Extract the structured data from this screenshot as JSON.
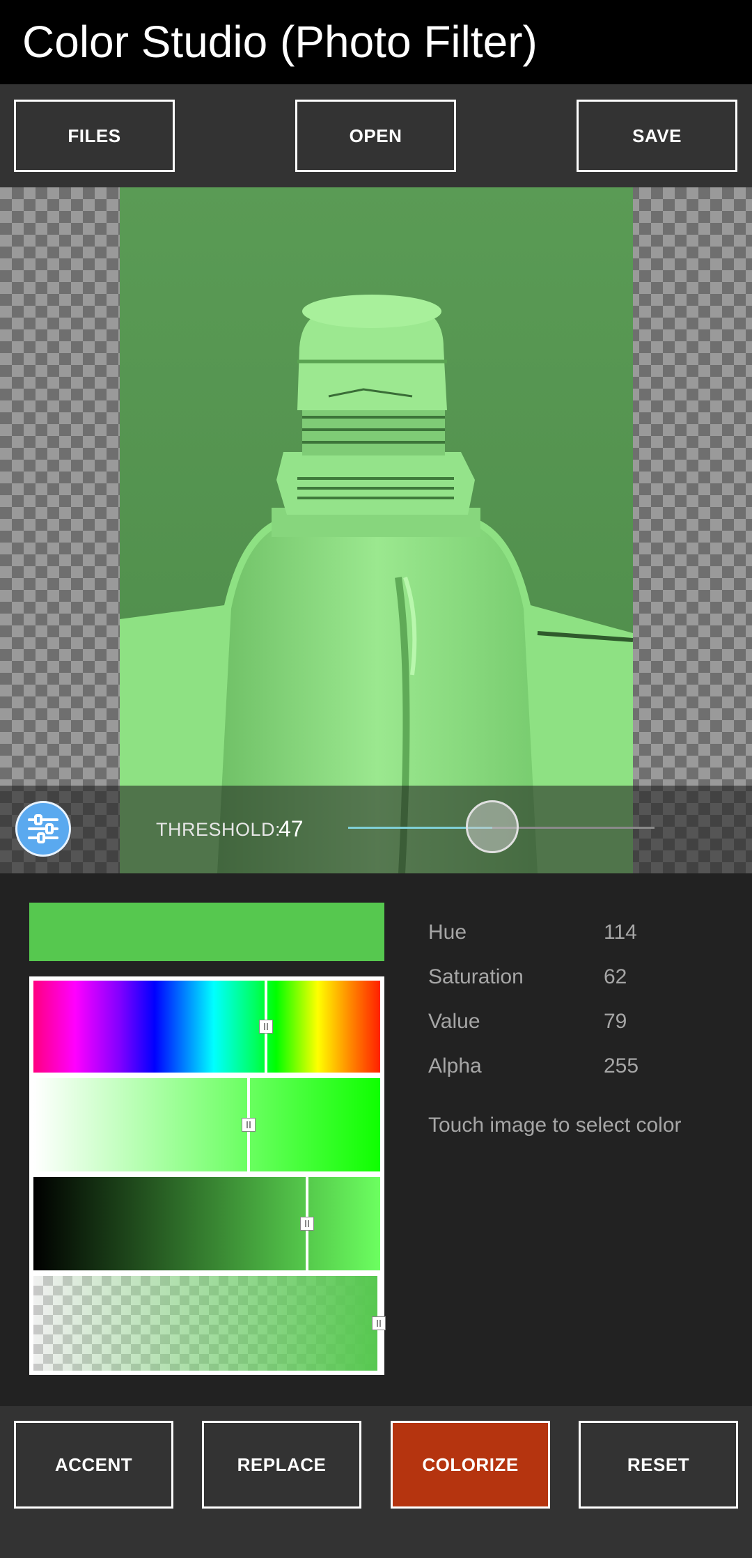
{
  "app": {
    "title": "Color Studio (Photo Filter)"
  },
  "toolbar": {
    "files_label": "FILES",
    "open_label": "OPEN",
    "save_label": "SAVE"
  },
  "threshold": {
    "label": "THRESHOLD:",
    "value": "47",
    "slider_fraction": 0.47
  },
  "color": {
    "swatch_hex": "#56c84f",
    "hue_label": "Hue",
    "hue_value": "114",
    "saturation_label": "Saturation",
    "saturation_value": "62",
    "value_label": "Value",
    "value_value": "79",
    "alpha_label": "Alpha",
    "alpha_value": "255",
    "hint": "Touch image to select color"
  },
  "picker": {
    "hue": 114,
    "saturation": 62,
    "value": 79,
    "alpha": 255
  },
  "actions": {
    "accent_label": "ACCENT",
    "replace_label": "REPLACE",
    "colorize_label": "COLORIZE",
    "reset_label": "RESET",
    "active_color": "#b5340f"
  },
  "icons": {
    "filter": "sliders-icon"
  }
}
